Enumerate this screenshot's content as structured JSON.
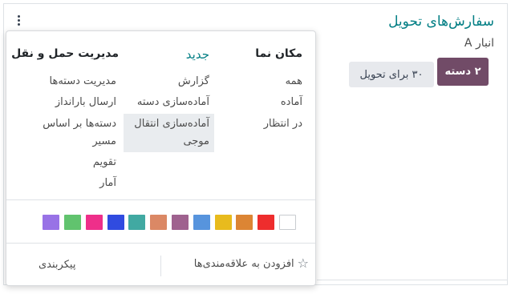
{
  "card": {
    "title": "سفارش‌های تحویل",
    "subtitle": "انبار A",
    "batch_button": "۲ دسته",
    "ready_button": "۳۰ برای تحویل"
  },
  "menu": {
    "view": {
      "heading": "مکان نما",
      "items": [
        "همه",
        "آماده",
        "در انتظار"
      ]
    },
    "new": {
      "heading": "جدید",
      "items": [
        "گزارش",
        "آماده‌سازی دسته",
        "آماده‌سازی انتقال موجی"
      ]
    },
    "logistics": {
      "heading": "مدیریت حمل و نقل",
      "items": [
        "مدیریت دسته‌ها",
        "ارسال بارانداز",
        "دسته‌ها بر اساس مسیر",
        "تقویم",
        "آمار"
      ]
    },
    "colors": [
      "#ffffff",
      "#ee2d2d",
      "#dc8534",
      "#e8bb1d",
      "#5794dd",
      "#9f628f",
      "#db8865",
      "#41a9a2",
      "#304be0",
      "#ee2f8a",
      "#61c36e",
      "#9872e6"
    ],
    "favorite_label": "افزودن به علاقه‌مندی‌ها",
    "configure_label": "پیکربندی"
  }
}
